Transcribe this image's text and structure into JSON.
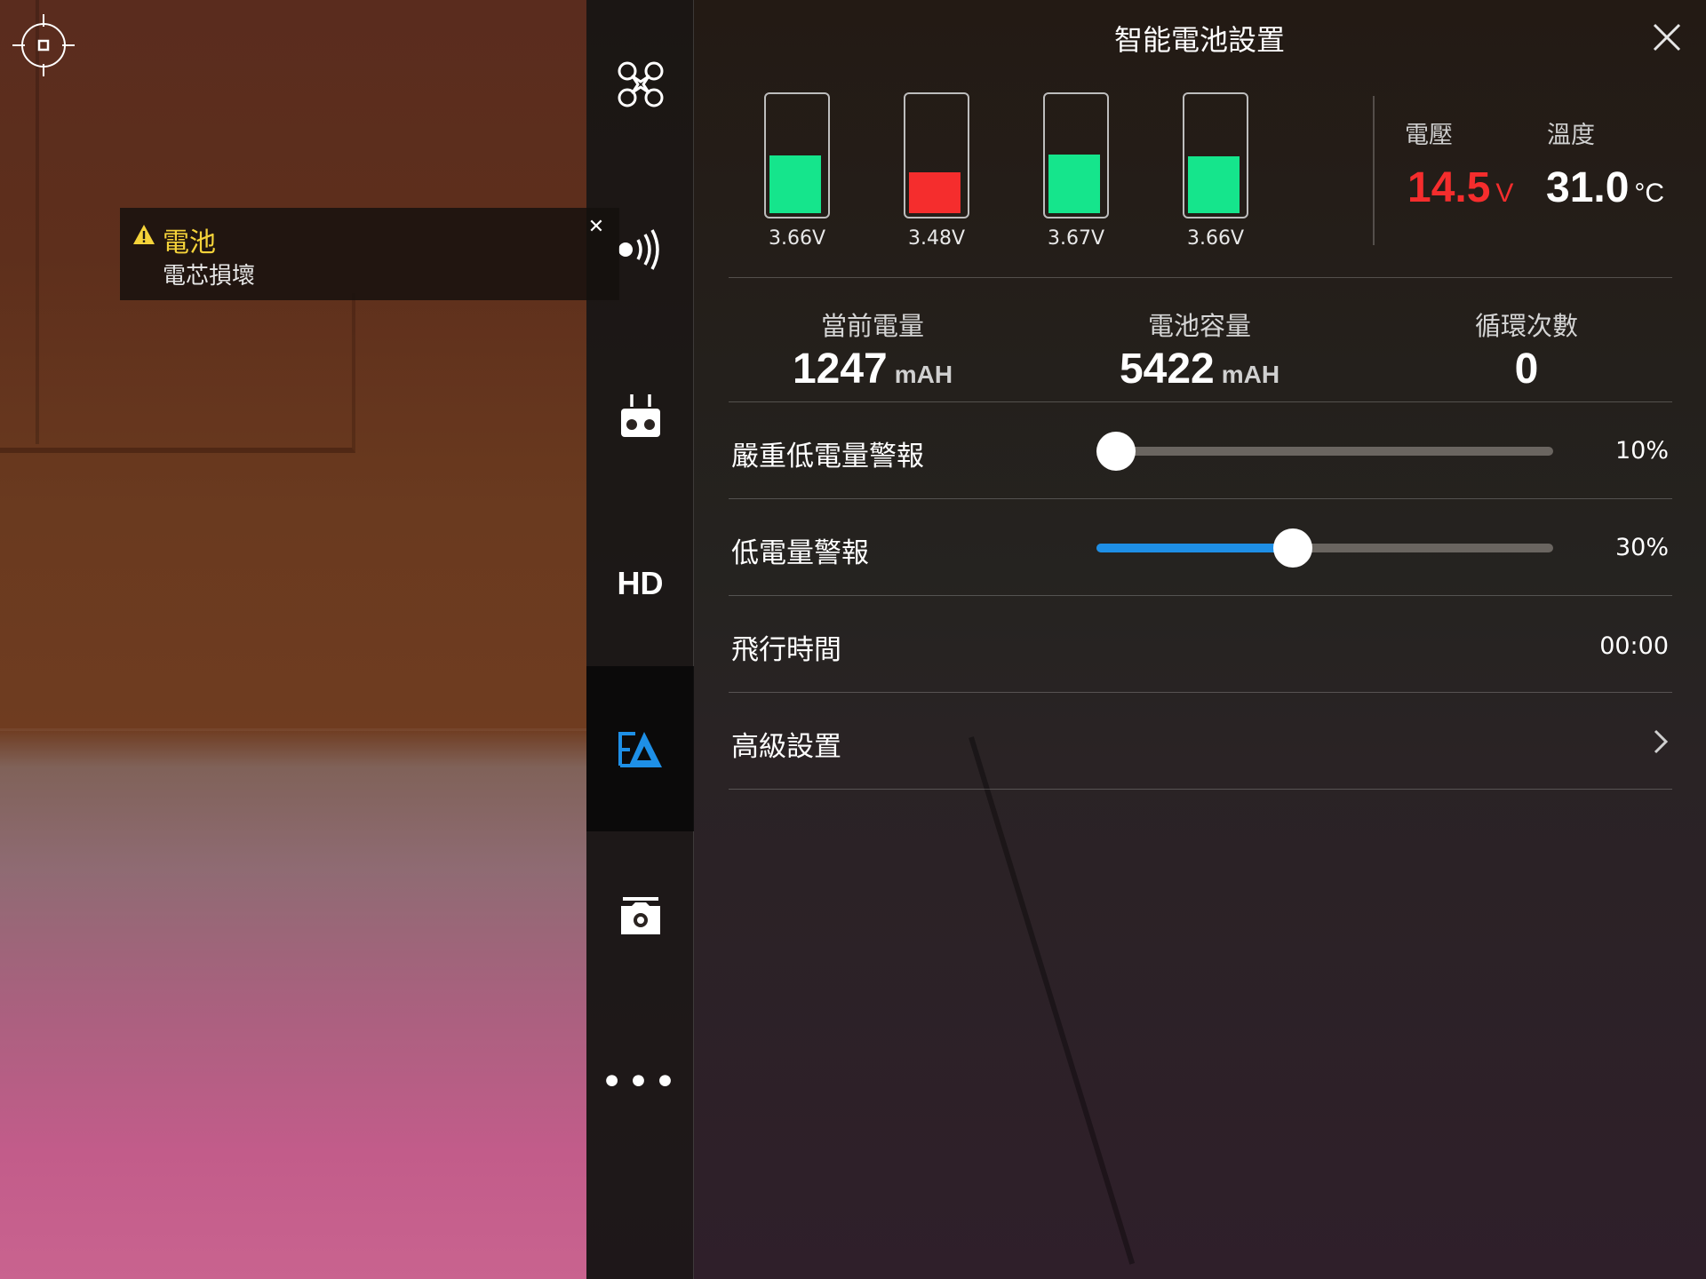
{
  "warning": {
    "title": "電池",
    "message": "電芯損壞"
  },
  "strip": {
    "hd_label": "HD",
    "more_label": "•••",
    "active_item": "battery",
    "accent_color": "#1e8fe6"
  },
  "panel": {
    "title": "智能電池設置",
    "cells": [
      {
        "voltage": "3.66V",
        "level": 0.5,
        "color": "#15e58c"
      },
      {
        "voltage": "3.48V",
        "level": 0.35,
        "color": "#f52d2d"
      },
      {
        "voltage": "3.67V",
        "level": 0.51,
        "color": "#15e58c"
      },
      {
        "voltage": "3.66V",
        "level": 0.49,
        "color": "#15e58c"
      }
    ],
    "voltage_label": "電壓",
    "voltage_value": "14.5",
    "voltage_unit": "V",
    "voltage_color": "#f52d2d",
    "temperature_label": "溫度",
    "temperature_value": "31.0",
    "temperature_unit": "°C",
    "current_charge_label": "當前電量",
    "current_charge_value": "1247",
    "current_charge_unit": "mAH",
    "capacity_label": "電池容量",
    "capacity_value": "5422",
    "capacity_unit": "mAH",
    "cycles_label": "循環次數",
    "cycles_value": "0",
    "critical_low_label": "嚴重低電量警報",
    "critical_low_value": "10%",
    "critical_low_fraction": 0.0,
    "low_label": "低電量警報",
    "low_value": "30%",
    "low_fraction": 0.43,
    "flight_time_label": "飛行時間",
    "flight_time_value": "00:00",
    "advanced_label": "高級設置"
  }
}
